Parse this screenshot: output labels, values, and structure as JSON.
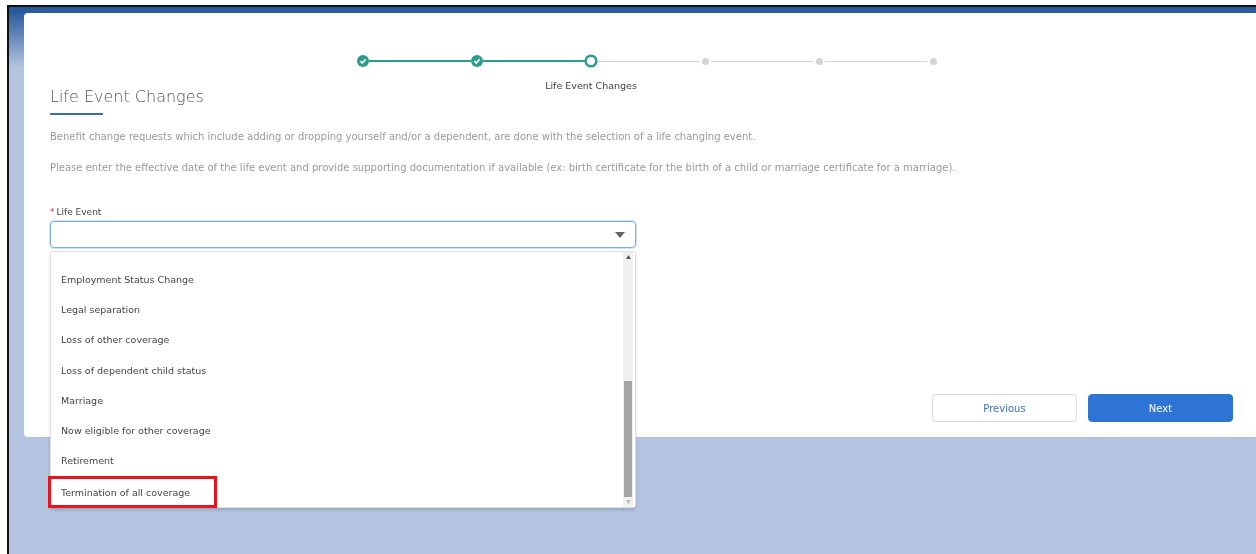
{
  "progress": {
    "steps": [
      {
        "complete": true,
        "current": false
      },
      {
        "complete": true,
        "current": false
      },
      {
        "complete": false,
        "current": true,
        "label": "Life Event Changes"
      },
      {
        "complete": false,
        "current": false
      },
      {
        "complete": false,
        "current": false
      },
      {
        "complete": false,
        "current": false
      }
    ]
  },
  "section": {
    "title": "Life Event Changes",
    "paragraphs": [
      "Benefit change requests which include adding or dropping yourself and/or a dependent, are done with the selection of a life changing event.",
      "Please enter the effective date of the life event and provide supporting documentation if available (ex: birth certificate for the birth of a child or marriage certificate for a marriage)."
    ]
  },
  "life_event": {
    "label": "Life Event",
    "required_mark": "*",
    "expanded": true,
    "options": [
      {
        "label": "Employment Status Change",
        "highlighted": false
      },
      {
        "label": "Legal separation",
        "highlighted": false
      },
      {
        "label": "Loss of other coverage",
        "highlighted": false
      },
      {
        "label": "Loss of dependent child status",
        "highlighted": false
      },
      {
        "label": "Marriage",
        "highlighted": false
      },
      {
        "label": "Now eligible for other coverage",
        "highlighted": false
      },
      {
        "label": "Retirement",
        "highlighted": false
      },
      {
        "label": "Termination of all coverage",
        "highlighted": true
      }
    ]
  },
  "buttons": [
    {
      "label": "Previous",
      "kind": "neutral"
    },
    {
      "label": "Next",
      "kind": "brand"
    }
  ]
}
